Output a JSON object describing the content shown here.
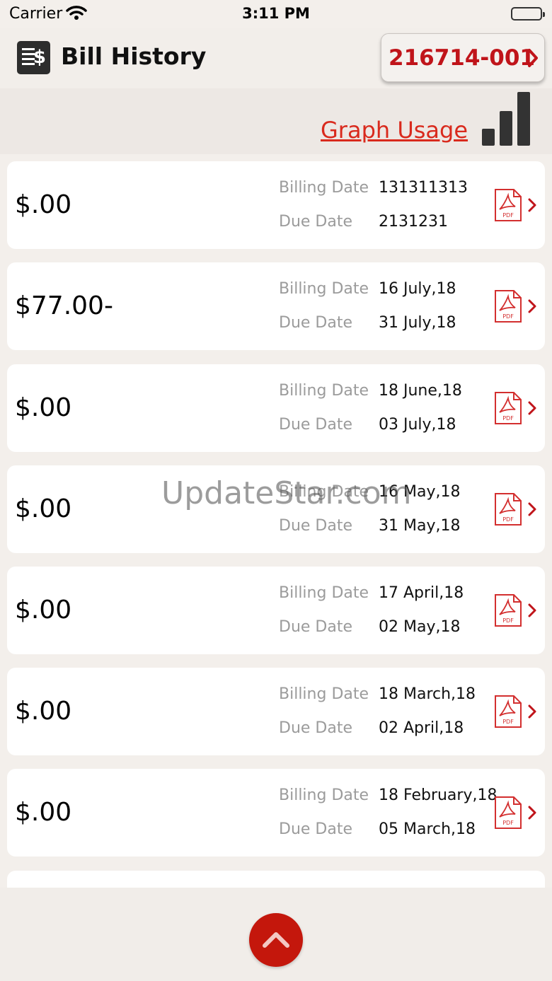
{
  "status_bar": {
    "carrier": "Carrier",
    "time": "3:11 PM"
  },
  "header": {
    "title": "Bill History",
    "account_number": "216714-001"
  },
  "graph": {
    "link_text": "Graph Usage"
  },
  "bills": [
    {
      "amount": "$.00",
      "billing_label": "Billing Date",
      "billing_date": "131311313",
      "due_label": "Due Date",
      "due_date": "2131231"
    },
    {
      "amount": "$77.00-",
      "billing_label": "Billing Date",
      "billing_date": "16 July,18",
      "due_label": "Due Date",
      "due_date": "31 July,18"
    },
    {
      "amount": "$.00",
      "billing_label": "Billing Date",
      "billing_date": "18 June,18",
      "due_label": "Due Date",
      "due_date": "03 July,18"
    },
    {
      "amount": "$.00",
      "billing_label": "Billing Date",
      "billing_date": "16 May,18",
      "due_label": "Due Date",
      "due_date": "31 May,18"
    },
    {
      "amount": "$.00",
      "billing_label": "Billing Date",
      "billing_date": "17 April,18",
      "due_label": "Due Date",
      "due_date": "02 May,18"
    },
    {
      "amount": "$.00",
      "billing_label": "Billing Date",
      "billing_date": "18 March,18",
      "due_label": "Due Date",
      "due_date": "02 April,18"
    },
    {
      "amount": "$.00",
      "billing_label": "Billing Date",
      "billing_date": "18 February,18",
      "due_label": "Due Date",
      "due_date": "05 March,18"
    }
  ],
  "pdf_label": "PDF",
  "watermark": "UpdateStar.com",
  "colors": {
    "accent": "#c0141a",
    "link": "#d92a1d",
    "background": "#f3efeb"
  },
  "icons": {
    "bill": "bill-dollar-icon",
    "graph": "bar-chart-icon",
    "pdf": "pdf-icon",
    "chevron": "chevron-right-icon",
    "scroll_top": "chevron-up-icon"
  }
}
